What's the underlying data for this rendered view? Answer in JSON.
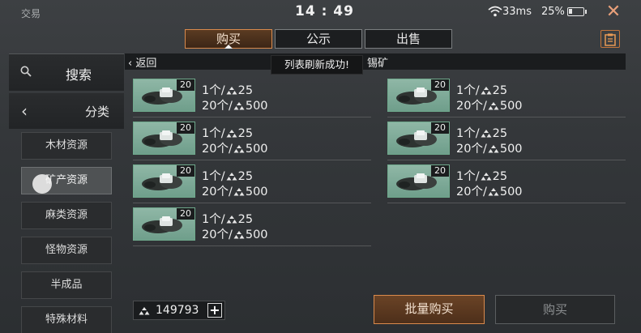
{
  "status": {
    "app_title": "交易",
    "time": "14 : 49",
    "ping": "33ms",
    "battery": "25%",
    "battery_level": 0.25
  },
  "tabs": [
    {
      "label": "购买",
      "active": true
    },
    {
      "label": "公示",
      "active": false
    },
    {
      "label": "出售",
      "active": false
    }
  ],
  "sidebar": {
    "search_label": "搜索",
    "category_label": "分类",
    "categories": [
      "木材资源",
      "矿产资源",
      "麻类资源",
      "怪物资源",
      "半成品",
      "特殊材料"
    ],
    "selected_category": "矿产资源"
  },
  "header": {
    "back_label": "返回",
    "category_name": "锡矿"
  },
  "toast": "列表刷新成功!",
  "listings": [
    {
      "qty": "20",
      "line1": "1个/",
      "price1": "25",
      "line2": "20个/",
      "price2": "500"
    },
    {
      "qty": "20",
      "line1": "1个/",
      "price1": "25",
      "line2": "20个/",
      "price2": "500"
    },
    {
      "qty": "20",
      "line1": "1个/",
      "price1": "25",
      "line2": "20个/",
      "price2": "500"
    },
    {
      "qty": "20",
      "line1": "1个/",
      "price1": "25",
      "line2": "20个/",
      "price2": "500"
    },
    {
      "qty": "20",
      "line1": "1个/",
      "price1": "25",
      "line2": "20个/",
      "price2": "500"
    },
    {
      "qty": "20",
      "line1": "1个/",
      "price1": "25",
      "line2": "20个/",
      "price2": "500"
    },
    {
      "qty": "20",
      "line1": "1个/",
      "price1": "25",
      "line2": "20个/",
      "price2": "500"
    }
  ],
  "footer": {
    "balance": "149793",
    "plus": "+",
    "bulk_buy_label": "批量购买",
    "buy_label": "购买"
  },
  "icons": {
    "close": "close-icon",
    "clipboard": "clipboard-icon",
    "search": "search-icon",
    "back": "chevron-left-icon",
    "currency": "coin-icon",
    "item": "tin-ore-icon"
  },
  "colors": {
    "accent": "#d98a4d",
    "item_bg": "#7fae9a"
  }
}
